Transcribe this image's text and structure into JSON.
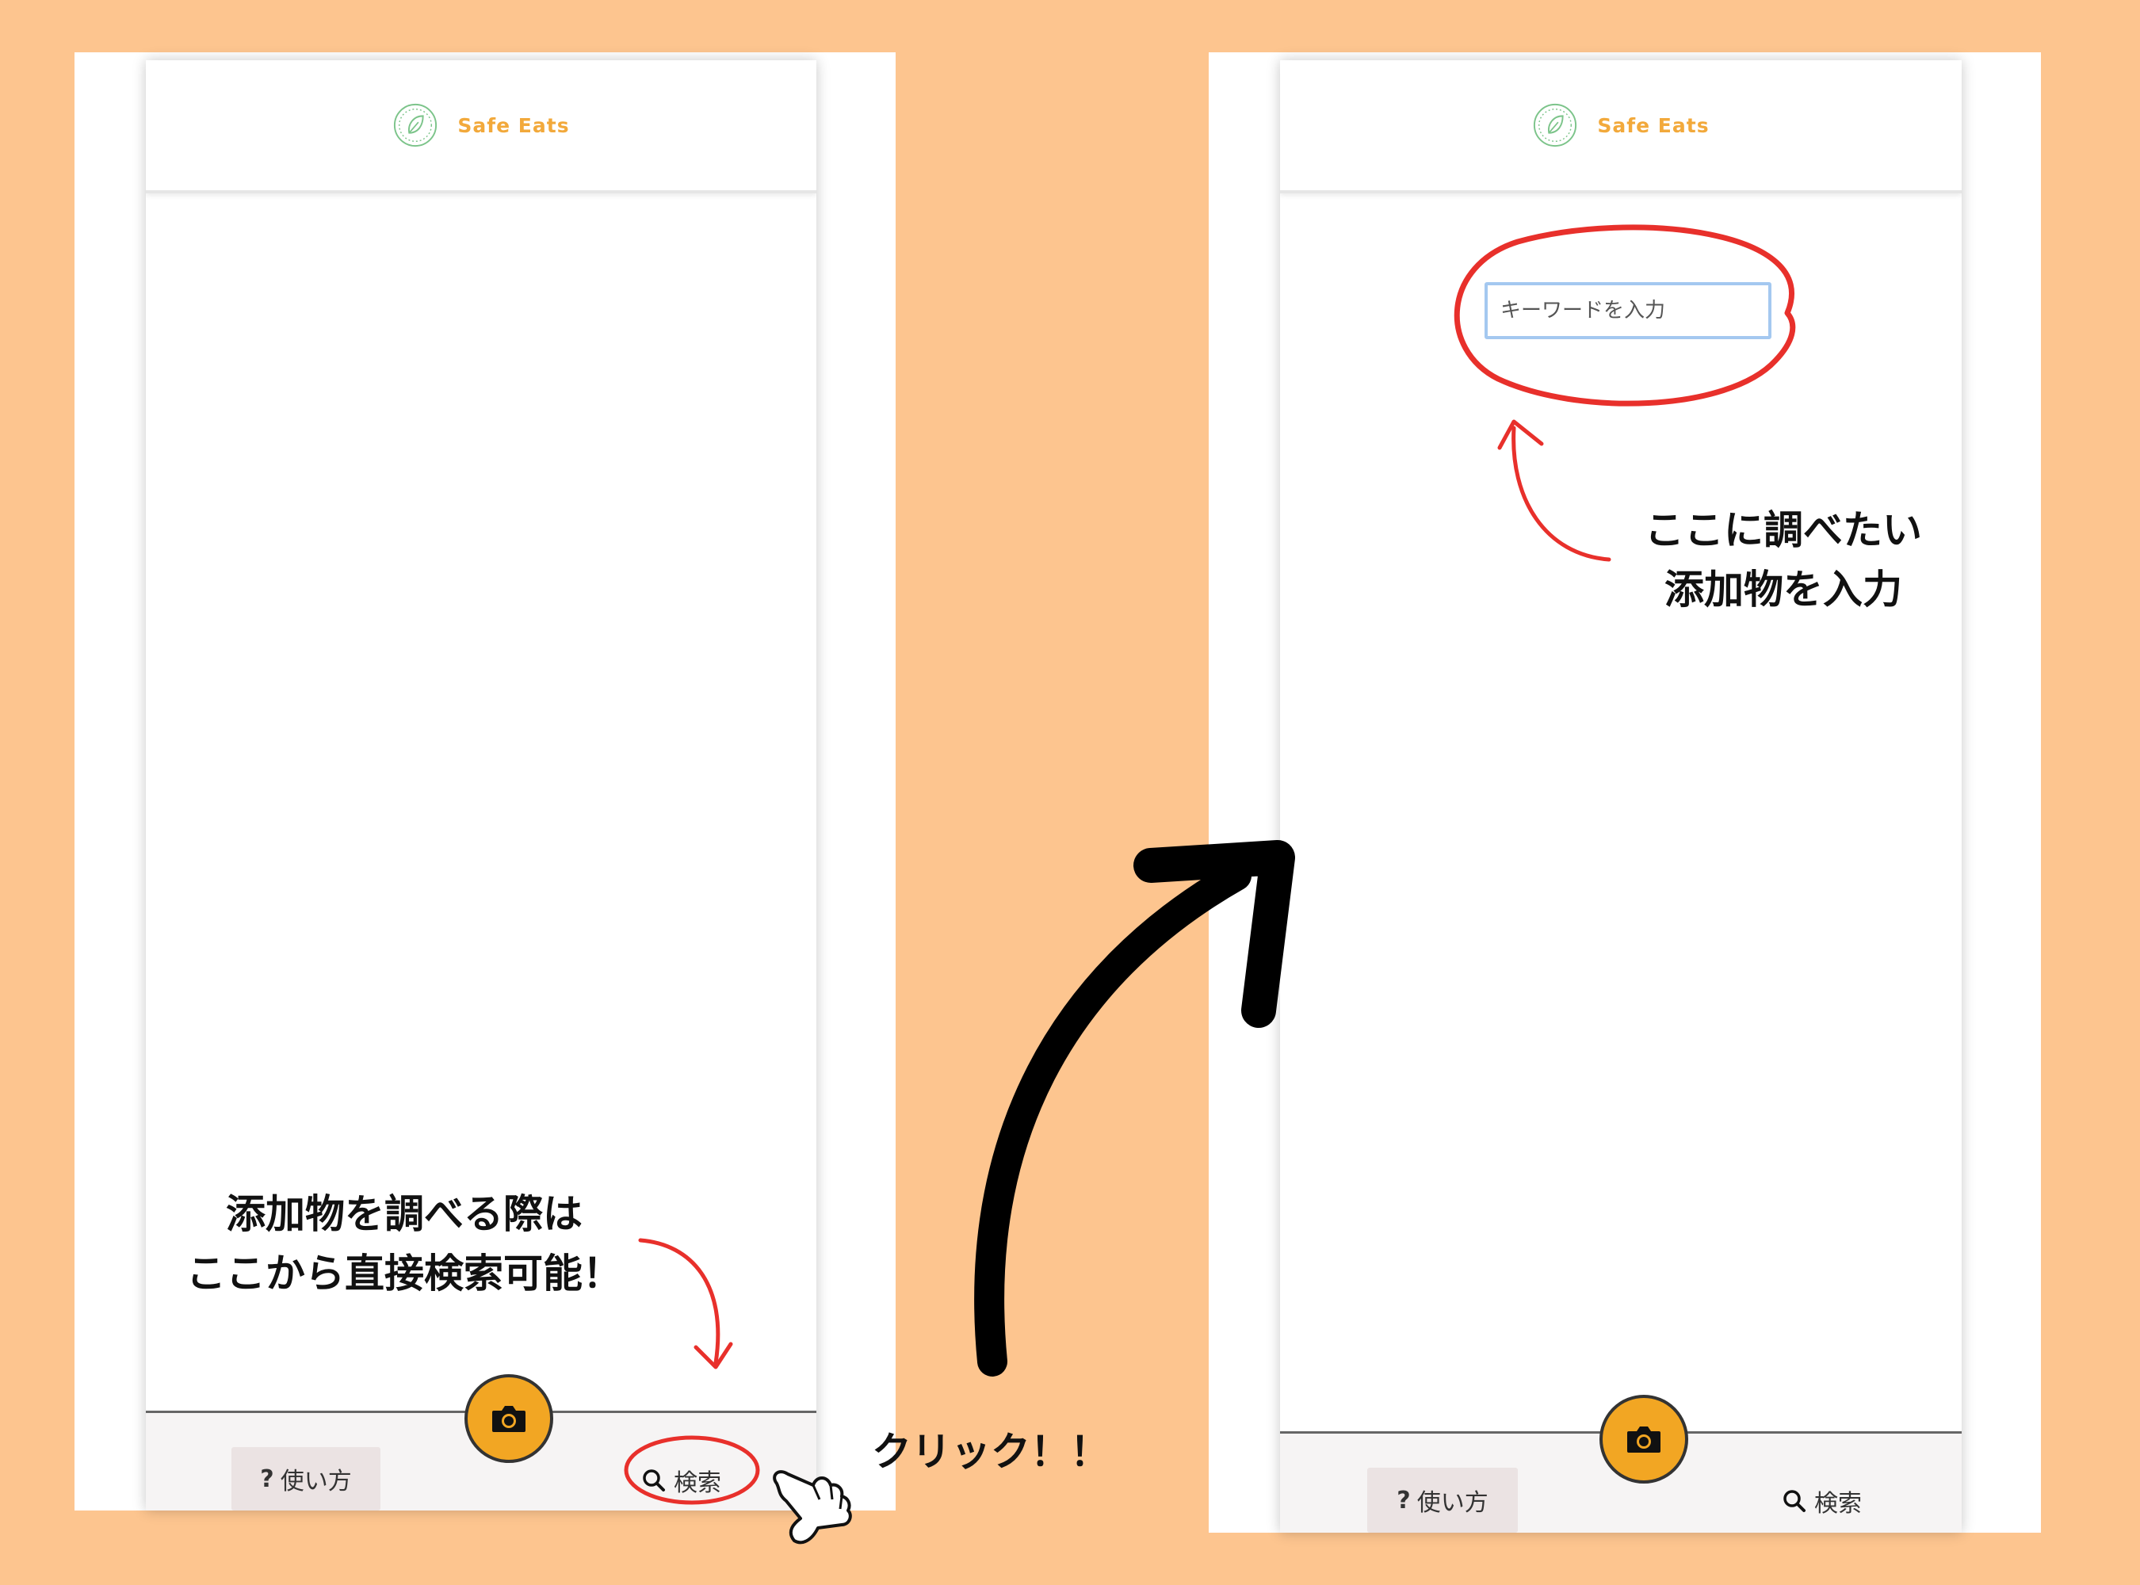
{
  "app": {
    "title": "Safe Eats"
  },
  "nav": {
    "help_label": "使い方",
    "help_icon": "?",
    "search_label": "検索"
  },
  "search": {
    "placeholder": "キーワードを入力"
  },
  "annotations": {
    "left_line1": "添加物を調べる際は",
    "left_line2": "ここから直接検索可能！",
    "click": "クリック！！",
    "right_line1": "ここに調べたい",
    "right_line2": "添加物を入力"
  },
  "icons": {
    "logo": "leaf-logo-icon",
    "camera": "camera-icon",
    "search": "search-icon",
    "pointer": "pointing-hand-icon",
    "arrow": "curved-arrow-icon"
  },
  "colors": {
    "background": "#FDC58F",
    "brand": "#F2A93B",
    "camera_button": "#F2A623",
    "highlight": "#E8302B",
    "logo_green": "#7CC48A",
    "input_border": "#A4C8F0"
  }
}
